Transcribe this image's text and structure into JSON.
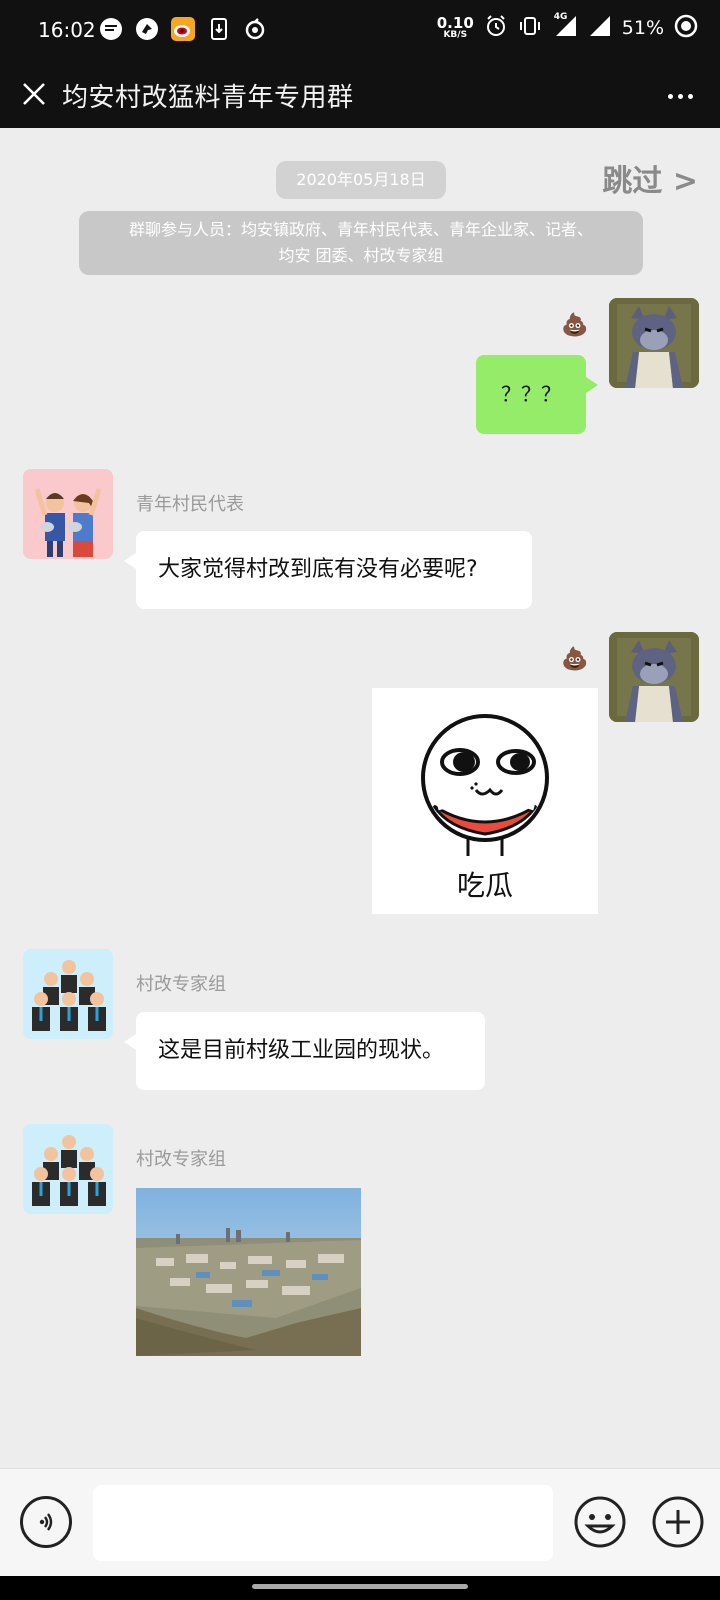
{
  "status_bar": {
    "time": "16:02",
    "speed_value": "0.10",
    "speed_unit": "KB/S",
    "network": "4G",
    "battery": "51%"
  },
  "header": {
    "title": "均安村改猛料青年专用群"
  },
  "chat": {
    "date": "2020年05月18日",
    "skip_label": "跳过 >",
    "system_notice_line1": "群聊参与人员：均安镇政府、青年村民代表、青年企业家、记者、",
    "system_notice_line2": "均安 团委、村改专家组",
    "messages": [
      {
        "from": "me",
        "type": "text",
        "text": "？？？"
      },
      {
        "from": "other",
        "sender": "青年村民代表",
        "type": "text",
        "text": "大家觉得村改到底有没有必要呢?"
      },
      {
        "from": "me",
        "type": "sticker",
        "caption": "吃瓜"
      },
      {
        "from": "other",
        "sender": "村改专家组",
        "type": "text",
        "text": "这是目前村级工业园的现状。"
      },
      {
        "from": "other",
        "sender": "村改专家组",
        "type": "image"
      }
    ]
  },
  "icons": {
    "poop": "💩",
    "close": "close-icon",
    "more": "more-icon",
    "voice": "voice-icon",
    "emoji": "emoji-icon",
    "plus": "plus-icon"
  },
  "colors": {
    "my_bubble": "#95ec69",
    "header_bg": "#111111",
    "chat_bg": "#ededed"
  }
}
